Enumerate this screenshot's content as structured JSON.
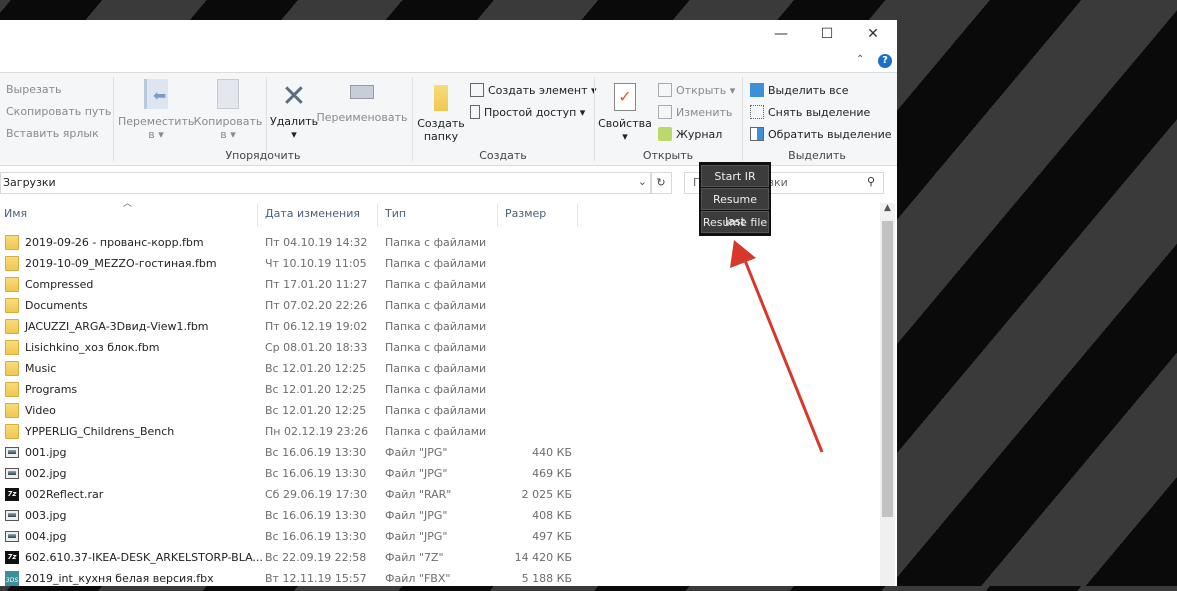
{
  "window": {
    "minimize": "—",
    "maximize": "☐",
    "close": "✕",
    "help": "?",
    "collapse": "⌃"
  },
  "ribbon": {
    "clipboard": {
      "cut": "Вырезать",
      "copy_path": "Скопировать путь",
      "paste_shortcut": "Вставить ярлык"
    },
    "organize": {
      "label": "Упорядочить",
      "move": "Переместить",
      "move_sub": "в ▾",
      "copy": "Копировать",
      "copy_sub": "в ▾",
      "delete": "Удалить",
      "delete_sub": "▾",
      "rename": "Переименовать"
    },
    "create": {
      "label": "Создать",
      "new_folder": "Создать",
      "new_folder2": "папку",
      "new_item": "Создать элемент ▾",
      "easy_access": "Простой доступ ▾"
    },
    "open": {
      "label": "Открыть",
      "properties": "Свойства",
      "properties_sub": "▾",
      "open": "Открыть ▾",
      "edit": "Изменить",
      "history": "Журнал"
    },
    "select": {
      "label": "Выделить",
      "select_all": "Выделить все",
      "select_none": "Снять выделение",
      "invert": "Обратить выделение"
    }
  },
  "address": {
    "path": "Загрузки",
    "search_placeholder": "Поиск: Загрузки"
  },
  "columns": {
    "name": "Имя",
    "date": "Дата изменения",
    "type": "Тип",
    "size": "Размер"
  },
  "files": [
    {
      "icon": "folder",
      "name": "2019-09-26 - прованс-корр.fbm",
      "date": "Пт 04.10.19 14:32",
      "type": "Папка с файлами",
      "size": ""
    },
    {
      "icon": "folder",
      "name": "2019-10-09_MEZZO-гостиная.fbm",
      "date": "Чт 10.10.19 11:05",
      "type": "Папка с файлами",
      "size": ""
    },
    {
      "icon": "folder",
      "name": "Compressed",
      "date": "Пт 17.01.20 11:27",
      "type": "Папка с файлами",
      "size": ""
    },
    {
      "icon": "folder",
      "name": "Documents",
      "date": "Пт 07.02.20 22:26",
      "type": "Папка с файлами",
      "size": ""
    },
    {
      "icon": "folder",
      "name": "JACUZZI_ARGA-3Dвид-View1.fbm",
      "date": "Пт 06.12.19 19:02",
      "type": "Папка с файлами",
      "size": ""
    },
    {
      "icon": "folder",
      "name": "Lisichkino_хоз блок.fbm",
      "date": "Ср 08.01.20 18:33",
      "type": "Папка с файлами",
      "size": ""
    },
    {
      "icon": "folder",
      "name": "Music",
      "date": "Вс 12.01.20 12:25",
      "type": "Папка с файлами",
      "size": ""
    },
    {
      "icon": "folder",
      "name": "Programs",
      "date": "Вс 12.01.20 12:25",
      "type": "Папка с файлами",
      "size": ""
    },
    {
      "icon": "folder",
      "name": "Video",
      "date": "Вс 12.01.20 12:25",
      "type": "Папка с файлами",
      "size": ""
    },
    {
      "icon": "folder",
      "name": "YPPERLIG_Childrens_Bench",
      "date": "Пн 02.12.19 23:26",
      "type": "Папка с файлами",
      "size": ""
    },
    {
      "icon": "image",
      "name": "001.jpg",
      "date": "Вс 16.06.19 13:30",
      "type": "Файл \"JPG\"",
      "size": "440 КБ"
    },
    {
      "icon": "image",
      "name": "002.jpg",
      "date": "Вс 16.06.19 13:30",
      "type": "Файл \"JPG\"",
      "size": "469 КБ"
    },
    {
      "icon": "7z",
      "name": "002Reflect.rar",
      "date": "Сб 29.06.19 17:30",
      "type": "Файл \"RAR\"",
      "size": "2 025 КБ"
    },
    {
      "icon": "image",
      "name": "003.jpg",
      "date": "Вс 16.06.19 13:30",
      "type": "Файл \"JPG\"",
      "size": "408 КБ"
    },
    {
      "icon": "image",
      "name": "004.jpg",
      "date": "Вс 16.06.19 13:30",
      "type": "Файл \"JPG\"",
      "size": "497 КБ"
    },
    {
      "icon": "7z",
      "name": "602.610.37-IKEA-DESK_ARKELSTORP-BLA...",
      "date": "Вс 22.09.19 22:58",
      "type": "Файл \"7Z\"",
      "size": "14 420 КБ"
    },
    {
      "icon": "fbx",
      "name": "2019_int_кухня белая версия.fbx",
      "date": "Вт 12.11.19 15:57",
      "type": "Файл \"FBX\"",
      "size": "5 188 КБ"
    }
  ],
  "popup": {
    "items": [
      "Start IR",
      "Resume last",
      "Resume file"
    ]
  },
  "icon_labels": {
    "7z": "7z",
    "fbx": "3DS"
  },
  "colors": {
    "arrow": "#d8372b",
    "accent": "#1a6fc8"
  }
}
